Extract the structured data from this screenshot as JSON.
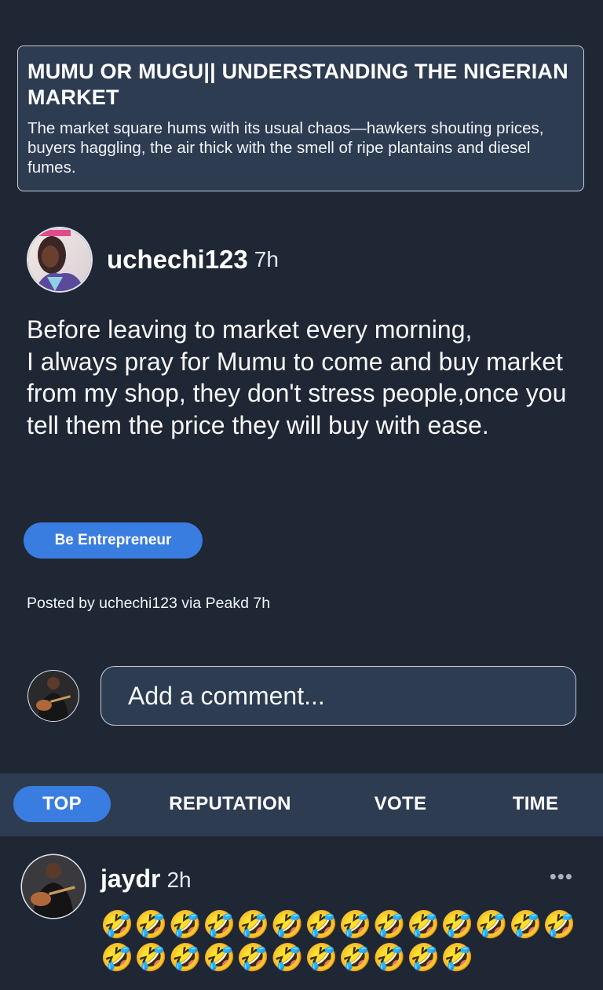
{
  "post_card": {
    "title": "MUMU OR MUGU|| UNDERSTANDING THE NIGERIAN MARKET",
    "excerpt": "The market square hums with its usual chaos—hawkers shouting prices, buyers haggling, the air thick with the smell of ripe plantains and diesel fumes."
  },
  "author": {
    "name": "uchechi123",
    "time": "7h"
  },
  "post": {
    "body_line1": "Before leaving to market every morning,",
    "body_line2": "I always pray for Mumu to come and buy market from my shop, they don't stress people,once you tell them the price they will buy with ease.",
    "tag_label": "Be Entrepreneur",
    "posted_by": "Posted by uchechi123 via Peakd 7h"
  },
  "comment_box": {
    "placeholder": "Add a comment..."
  },
  "sort_tabs": [
    {
      "label": "TOP",
      "active": true
    },
    {
      "label": "REPUTATION",
      "active": false
    },
    {
      "label": "VOTE",
      "active": false
    },
    {
      "label": "TIME",
      "active": false
    }
  ],
  "comments": [
    {
      "author": "jaydr",
      "time": "2h",
      "more_icon": "•••",
      "text": "🤣🤣🤣🤣🤣🤣🤣🤣🤣🤣🤣🤣🤣🤣🤣🤣🤣🤣🤣🤣🤣🤣🤣🤣🤣"
    }
  ],
  "colors": {
    "background": "#1f2734",
    "card": "#2e3c52",
    "accent": "#3a7de0"
  }
}
